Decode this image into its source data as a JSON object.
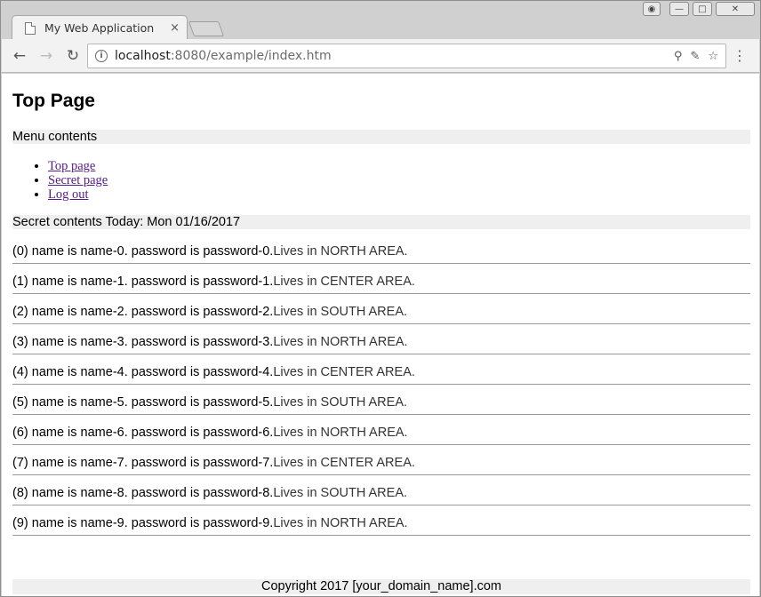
{
  "browser": {
    "tab_title": "My Web Application",
    "tab_close": "×",
    "url_host": "localhost",
    "url_rest": ":8080/example/index.htm",
    "back_icon": "back-arrow-icon",
    "forward_icon": "forward-arrow-icon",
    "reload_icon": "reload-icon"
  },
  "page": {
    "title": "Top Page",
    "menu_header": "Menu contents",
    "menu": [
      {
        "label": "Top page"
      },
      {
        "label": "Secret page"
      },
      {
        "label": "Log out"
      }
    ],
    "secret_header": "Secret contents Today: Mon 01/16/2017",
    "records": [
      {
        "main": "(0) name is name-0. password is password-0.",
        "lives": " Lives in NORTH AREA."
      },
      {
        "main": "(1) name is name-1. password is password-1.",
        "lives": " Lives in CENTER AREA."
      },
      {
        "main": "(2) name is name-2. password is password-2.",
        "lives": " Lives in SOUTH AREA."
      },
      {
        "main": "(3) name is name-3. password is password-3.",
        "lives": " Lives in NORTH AREA."
      },
      {
        "main": "(4) name is name-4. password is password-4.",
        "lives": " Lives in CENTER AREA."
      },
      {
        "main": "(5) name is name-5. password is password-5.",
        "lives": " Lives in SOUTH AREA."
      },
      {
        "main": "(6) name is name-6. password is password-6.",
        "lives": " Lives in NORTH AREA."
      },
      {
        "main": "(7) name is name-7. password is password-7.",
        "lives": " Lives in CENTER AREA."
      },
      {
        "main": "(8) name is name-8. password is password-8.",
        "lives": " Lives in SOUTH AREA."
      },
      {
        "main": "(9) name is name-9. password is password-9.",
        "lives": " Lives in NORTH AREA."
      }
    ],
    "footer": "Copyright 2017 [your_domain_name].com"
  }
}
